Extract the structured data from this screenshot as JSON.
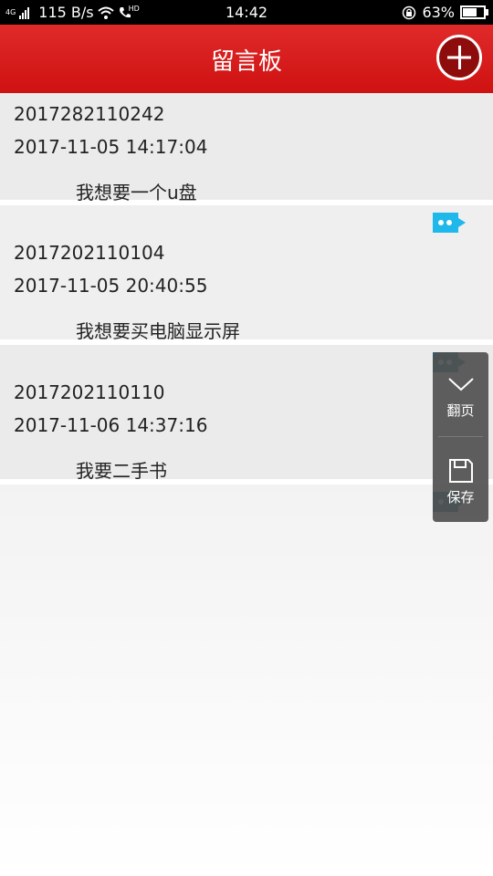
{
  "status_bar": {
    "network": "4G",
    "speed": "115 B/s",
    "hd": "HD",
    "time": "14:42",
    "battery": "63%"
  },
  "header": {
    "title": "留言板"
  },
  "messages": [
    {
      "id": "2017282110242",
      "time": "2017-11-05 14:17:04",
      "text": "我想要一个u盘"
    },
    {
      "id": "2017202110104",
      "time": "2017-11-05 20:40:55",
      "text": "我想要买电脑显示屏"
    },
    {
      "id": "2017202110110",
      "time": "2017-11-06 14:37:16",
      "text": "我要二手书"
    }
  ],
  "float_panel": {
    "page_label": "翻页",
    "save_label": "保存"
  },
  "colors": {
    "header_red": "#d51a1a",
    "chat_icon_blue": "#1eb8ea"
  }
}
